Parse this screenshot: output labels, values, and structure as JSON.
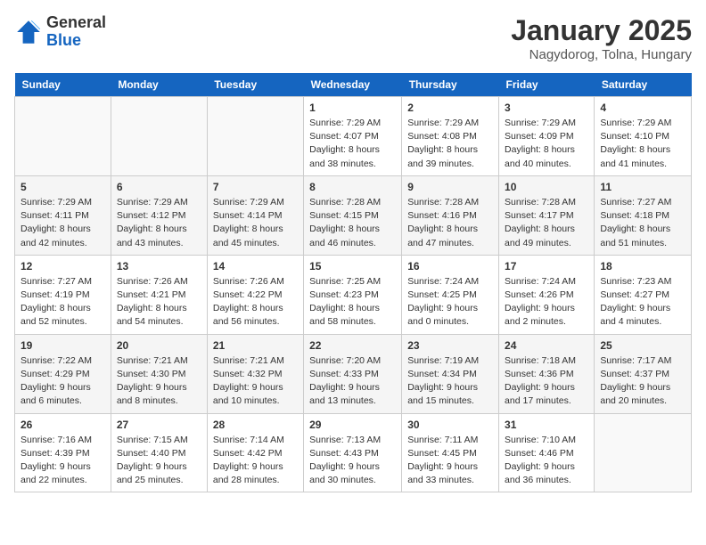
{
  "header": {
    "logo_line1": "General",
    "logo_line2": "Blue",
    "month": "January 2025",
    "location": "Nagydorog, Tolna, Hungary"
  },
  "days_of_week": [
    "Sunday",
    "Monday",
    "Tuesday",
    "Wednesday",
    "Thursday",
    "Friday",
    "Saturday"
  ],
  "weeks": [
    [
      {
        "day": "",
        "info": ""
      },
      {
        "day": "",
        "info": ""
      },
      {
        "day": "",
        "info": ""
      },
      {
        "day": "1",
        "info": "Sunrise: 7:29 AM\nSunset: 4:07 PM\nDaylight: 8 hours\nand 38 minutes."
      },
      {
        "day": "2",
        "info": "Sunrise: 7:29 AM\nSunset: 4:08 PM\nDaylight: 8 hours\nand 39 minutes."
      },
      {
        "day": "3",
        "info": "Sunrise: 7:29 AM\nSunset: 4:09 PM\nDaylight: 8 hours\nand 40 minutes."
      },
      {
        "day": "4",
        "info": "Sunrise: 7:29 AM\nSunset: 4:10 PM\nDaylight: 8 hours\nand 41 minutes."
      }
    ],
    [
      {
        "day": "5",
        "info": "Sunrise: 7:29 AM\nSunset: 4:11 PM\nDaylight: 8 hours\nand 42 minutes."
      },
      {
        "day": "6",
        "info": "Sunrise: 7:29 AM\nSunset: 4:12 PM\nDaylight: 8 hours\nand 43 minutes."
      },
      {
        "day": "7",
        "info": "Sunrise: 7:29 AM\nSunset: 4:14 PM\nDaylight: 8 hours\nand 45 minutes."
      },
      {
        "day": "8",
        "info": "Sunrise: 7:28 AM\nSunset: 4:15 PM\nDaylight: 8 hours\nand 46 minutes."
      },
      {
        "day": "9",
        "info": "Sunrise: 7:28 AM\nSunset: 4:16 PM\nDaylight: 8 hours\nand 47 minutes."
      },
      {
        "day": "10",
        "info": "Sunrise: 7:28 AM\nSunset: 4:17 PM\nDaylight: 8 hours\nand 49 minutes."
      },
      {
        "day": "11",
        "info": "Sunrise: 7:27 AM\nSunset: 4:18 PM\nDaylight: 8 hours\nand 51 minutes."
      }
    ],
    [
      {
        "day": "12",
        "info": "Sunrise: 7:27 AM\nSunset: 4:19 PM\nDaylight: 8 hours\nand 52 minutes."
      },
      {
        "day": "13",
        "info": "Sunrise: 7:26 AM\nSunset: 4:21 PM\nDaylight: 8 hours\nand 54 minutes."
      },
      {
        "day": "14",
        "info": "Sunrise: 7:26 AM\nSunset: 4:22 PM\nDaylight: 8 hours\nand 56 minutes."
      },
      {
        "day": "15",
        "info": "Sunrise: 7:25 AM\nSunset: 4:23 PM\nDaylight: 8 hours\nand 58 minutes."
      },
      {
        "day": "16",
        "info": "Sunrise: 7:24 AM\nSunset: 4:25 PM\nDaylight: 9 hours\nand 0 minutes."
      },
      {
        "day": "17",
        "info": "Sunrise: 7:24 AM\nSunset: 4:26 PM\nDaylight: 9 hours\nand 2 minutes."
      },
      {
        "day": "18",
        "info": "Sunrise: 7:23 AM\nSunset: 4:27 PM\nDaylight: 9 hours\nand 4 minutes."
      }
    ],
    [
      {
        "day": "19",
        "info": "Sunrise: 7:22 AM\nSunset: 4:29 PM\nDaylight: 9 hours\nand 6 minutes."
      },
      {
        "day": "20",
        "info": "Sunrise: 7:21 AM\nSunset: 4:30 PM\nDaylight: 9 hours\nand 8 minutes."
      },
      {
        "day": "21",
        "info": "Sunrise: 7:21 AM\nSunset: 4:32 PM\nDaylight: 9 hours\nand 10 minutes."
      },
      {
        "day": "22",
        "info": "Sunrise: 7:20 AM\nSunset: 4:33 PM\nDaylight: 9 hours\nand 13 minutes."
      },
      {
        "day": "23",
        "info": "Sunrise: 7:19 AM\nSunset: 4:34 PM\nDaylight: 9 hours\nand 15 minutes."
      },
      {
        "day": "24",
        "info": "Sunrise: 7:18 AM\nSunset: 4:36 PM\nDaylight: 9 hours\nand 17 minutes."
      },
      {
        "day": "25",
        "info": "Sunrise: 7:17 AM\nSunset: 4:37 PM\nDaylight: 9 hours\nand 20 minutes."
      }
    ],
    [
      {
        "day": "26",
        "info": "Sunrise: 7:16 AM\nSunset: 4:39 PM\nDaylight: 9 hours\nand 22 minutes."
      },
      {
        "day": "27",
        "info": "Sunrise: 7:15 AM\nSunset: 4:40 PM\nDaylight: 9 hours\nand 25 minutes."
      },
      {
        "day": "28",
        "info": "Sunrise: 7:14 AM\nSunset: 4:42 PM\nDaylight: 9 hours\nand 28 minutes."
      },
      {
        "day": "29",
        "info": "Sunrise: 7:13 AM\nSunset: 4:43 PM\nDaylight: 9 hours\nand 30 minutes."
      },
      {
        "day": "30",
        "info": "Sunrise: 7:11 AM\nSunset: 4:45 PM\nDaylight: 9 hours\nand 33 minutes."
      },
      {
        "day": "31",
        "info": "Sunrise: 7:10 AM\nSunset: 4:46 PM\nDaylight: 9 hours\nand 36 minutes."
      },
      {
        "day": "",
        "info": ""
      }
    ]
  ]
}
